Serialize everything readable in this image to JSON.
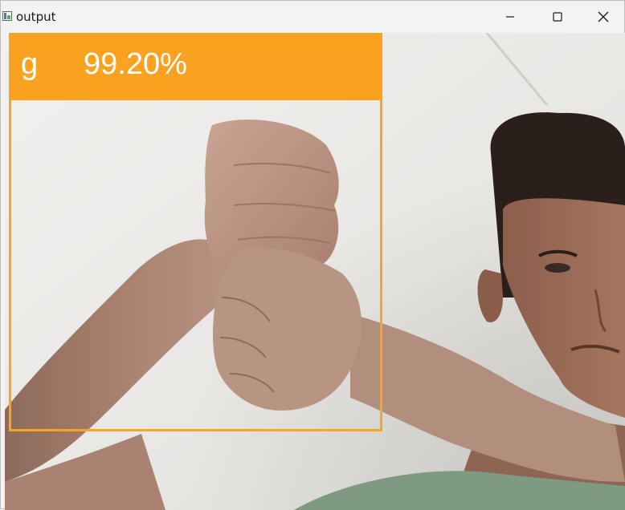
{
  "window": {
    "title": "output"
  },
  "detection": {
    "class_label": "g",
    "confidence": "99.20%",
    "box_color": "#f6a623",
    "label_bg_color": "#faa21f"
  }
}
